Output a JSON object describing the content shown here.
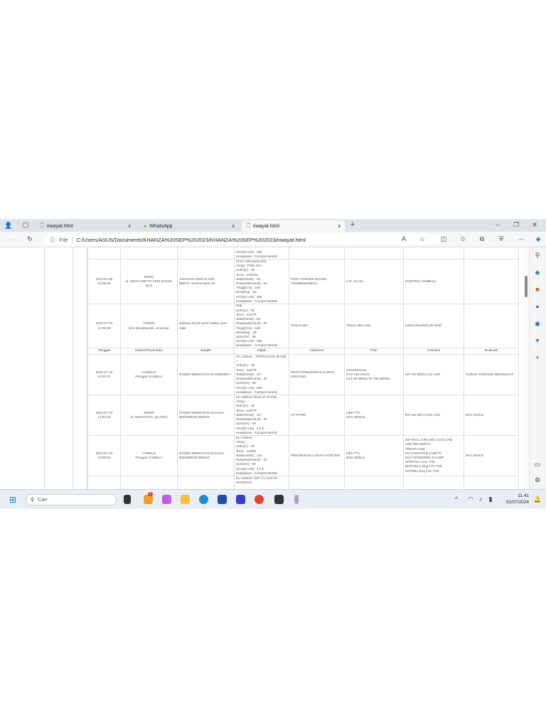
{
  "browser": {
    "tabs": [
      {
        "label": "riwayat.html",
        "close": "x"
      },
      {
        "label": "WhatsApp",
        "close": "x"
      },
      {
        "label": "riwayat.html",
        "close": "x",
        "active": true
      }
    ],
    "new_tab": "+",
    "site_label": "File",
    "url": "C:/Users/ASUS/Documents/KHANZA%20SEP%202023/KHANZA%20SEP%202023/riwayat.html"
  },
  "table": {
    "headers": [
      "Tanggal",
      "Dokter/Paramedis",
      "Subjek",
      "Objek",
      "Asesmen",
      "Plan",
      "Instruksi",
      "Evaluasi"
    ],
    "rows": [
      {
        "cells": [
          [],
          [],
          [],
          [
            "GCS(E,V,M) : 456",
            "Kesadaran : Compos Mentis"
          ],
          [],
          [],
          [],
          []
        ]
      },
      {
        "cells": [
          [
            "2024-07-30",
            "15:05:38"
          ],
          [
            "D0052",
            "dr. DWIH ANETTA APRI RUKMI,",
            "Sp.S"
          ],
          [
            "ANGGOTA GERAK KIRI",
            "BERAT, SUSAH MAKAN"
          ],
          [
            "POST BRANGKARD",
            "Alergi : TIDK ADA",
            "Suhu(C) : 36",
            "Tensi : 140/101",
            "Nadi(/menit) : 46",
            "Respirasi(/menit) : 20",
            "Tinggi(Cm) : 160",
            "Berat(Kg) : 83",
            "GCS(E,V,M) : 456",
            "Kesadaran : Compos Mentis"
          ],
          [
            "POST STROKE INFARK",
            "TROMBOEMBOLI"
          ],
          [
            "LAT JALAN"
          ],
          [
            "KONTROL KEMBALI"
          ],
          [
            "-"
          ]
        ]
      },
      {
        "cells": [
          [
            "2024-07-23",
            "12:08:38"
          ],
          [
            "P20020",
            "Erni Mesahyarsih, Amd.Kep"
          ],
          [
            "keluhan di poli saraf, badan nyeri",
            "sakit"
          ],
          [
            "skip",
            "Suhu(C) : 36",
            "Tensi : 112/78",
            "Nadi(/menit) : 83",
            "Respirasi(/menit) : 20",
            "Tinggi(Cm) : 160",
            "Berat(Kg) : 83",
            "SpO2(%) : 98",
            "GCS(E,V,M) : 456",
            "Kesadaran : Compos Mentis"
          ],
          [
            "kontrol rutin"
          ],
          [
            "minum obat rutin"
          ],
          [
            "kontrol kembali poli saraf"
          ],
          [
            "-"
          ]
        ]
      },
      {
        "header": true
      },
      {
        "cells": [
          [
            "2024-07-22",
            "14:00:21"
          ],
          [
            "CAMELIA",
            "Petugas CAMELIA"
          ],
          [
            "PASIEN MENGATAKAN DREDEG +"
          ],
          [
            "KU LEMAH , TERPASANG INTUB",
            "+",
            "Suhu(C) : 36",
            "Tensi : 140/79",
            "Nadi(/menit) : 117",
            "Respirasi(/menit) : 20",
            "SpO2(%) : 98",
            "GCS(E,V,M) : 456",
            "Kesadaran : Compos Mentis"
          ],
          [
            "RESTI PENURUNAN CURAH",
            "JANTUNG"
          ],
          [
            "OKSIGENASI",
            "KAJI KELUHAN",
            "KOLAB DENGAN TIM MEDIS"
          ],
          [
            "INF NS 500CC/ 24 JAM"
          ],
          [
            "CURAH JANTUNG MENINGKAT"
          ]
        ]
      },
      {
        "cells": [
          [
            "2024-07-23",
            "14:53:43"
          ],
          [
            "DR035",
            "dr. NURYANTO, Sp.JP(K)"
          ],
          [
            "PASIEN MENGATAKAN DADA",
            "BERDEBAR-DEBAR"
          ],
          [
            "KU LEMAH DGN AF RAPID",
            "Alergi : -",
            "Suhu(C) : 36",
            "Tensi : 140/79",
            "Nadi(/menit) : 117",
            "Respirasi(/menit) : 20",
            "SpO2(%) : 98",
            "GCS(E,V,M) : 4 5 6",
            "Kesadaran : Compos Mentis"
          ],
          [
            "AF RAPID"
          ],
          [
            "OBS TTV",
            "EKG SERIAL"
          ],
          [
            "INF NS 500 CC/24 JAM"
          ],
          [
            "EKG SINUS"
          ]
        ]
      },
      {
        "cells": [
          [
            "2024-07-23",
            "23:05:53"
          ],
          [
            "CAMELIA",
            "Petugas CAMELIA"
          ],
          [
            "PASIEN MENGATAKAN DADA",
            "BERDEBAR-DEBAR"
          ],
          [
            "KU LEMAH",
            "Alergi : -",
            "Suhu(C) : 36",
            "Tensi : 125/91",
            "Nadi(/menit) : 120",
            "Respirasi(/menit) : 20",
            "SpO2(%) : 98",
            "GCS(E,V,M) : 4 5 6",
            "Kesadaran : Compos Mentis"
          ],
          [
            "PENURUNAN CURAH JANTUNG"
          ],
          [
            "OBS TTV",
            "EKG SERIAL"
          ],
          [
            "INF NACL 0.9% 500 CC/24 JAM",
            "CEK INR SERIAL",
            "TERAPI-ASB",
            "INJ FARGOXIN 1AMP IV",
            "INJ FUROSEMID 2x1AMP",
            "SPIRTOLA 1X1 TAB",
            "BISOVELL 5mg 1X1 TAB",
            "NOTISIL 2mg 1X1 TAB"
          ],
          [
            "EKG SINUS"
          ]
        ]
      },
      {
        "cells": [
          [],
          [],
          [],
          [
            "KU LEMAH, INF (+), NAFAS",
            "SPONTAN"
          ],
          [],
          [],
          [],
          []
        ]
      }
    ]
  },
  "taskbar": {
    "search_placeholder": "Cari",
    "time": "11.41",
    "date": "31/07/2024",
    "badge": "1"
  }
}
